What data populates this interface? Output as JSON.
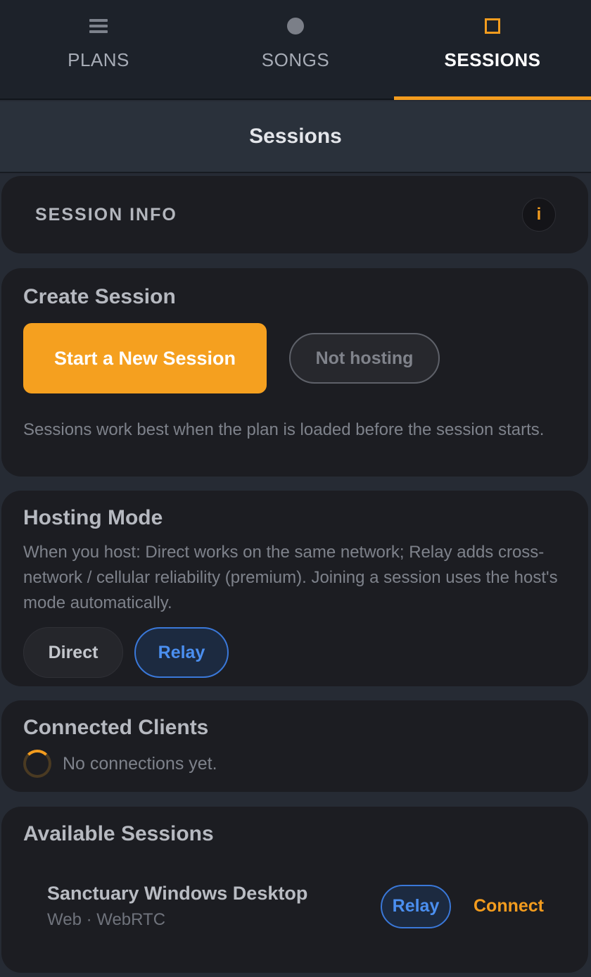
{
  "tabs": [
    {
      "label": "PLANS",
      "icon": "menu-icon"
    },
    {
      "label": "SONGS",
      "icon": "circle-icon"
    },
    {
      "label": "SESSIONS",
      "icon": "square-icon",
      "active": true
    }
  ],
  "header": {
    "title": "Sessions"
  },
  "session_info": {
    "title": "SESSION INFO",
    "info_glyph": "i"
  },
  "create_session": {
    "title": "Create Session",
    "start_button": "Start a New Session",
    "status_pill": "Not hosting",
    "hint": "Sessions work best when the plan is loaded before the session starts."
  },
  "hosting_mode": {
    "title": "Hosting Mode",
    "description": "When you host: Direct works on the same network; Relay adds cross-network / cellular reliability (premium). Joining a session uses the host's mode automatically.",
    "direct_label": "Direct",
    "relay_label": "Relay",
    "selected": "Relay"
  },
  "connected_clients": {
    "title": "Connected Clients",
    "empty_text": "No connections yet."
  },
  "available_sessions": {
    "title": "Available Sessions",
    "items": [
      {
        "name": "Sanctuary Windows Desktop",
        "meta": "Web · WebRTC",
        "mode": "Relay",
        "action": "Connect"
      }
    ]
  },
  "colors": {
    "accent": "#f5a01f",
    "relay_blue": "#3a78d9",
    "card_bg": "#1c1d22",
    "page_bg": "#262b34"
  }
}
